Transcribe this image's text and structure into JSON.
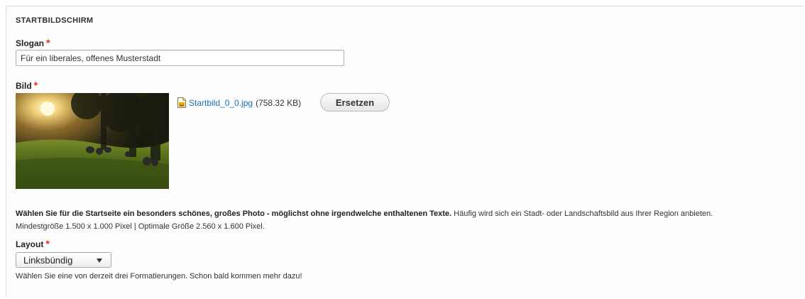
{
  "section": {
    "title": "STARTBILDSCHIRM"
  },
  "slogan": {
    "label": "Slogan",
    "required_mark": "*",
    "value": "Für ein liberales, offenes Musterstadt"
  },
  "image": {
    "label": "Bild",
    "required_mark": "*",
    "file_icon": "image-file-icon",
    "filename": "Startbild_0_0.jpg",
    "filesize": "(758.32 KB)",
    "replace_label": "Ersetzen",
    "description_bold": "Wählen Sie für die Startseite ein besonders schönes, großes Photo - möglichst ohne irgendwelche enthaltenen Texte.",
    "description_rest": " Häufig wird sich ein Stadt- oder Landschaftsbild aus Ihrer Region anbieten.",
    "size_hint": "Mindestgröße 1.500 x 1.000 Pixel | Optimale Größe 2.560 x 1.600 Pixel."
  },
  "layout": {
    "label": "Layout",
    "required_mark": "*",
    "selected": "Linksbündig",
    "help": "Wählen Sie eine von derzeit drei Formatierungen. Schon bald kommen mehr dazu!"
  },
  "colors": {
    "required": "#e0301e",
    "link": "#1a6fb3"
  }
}
